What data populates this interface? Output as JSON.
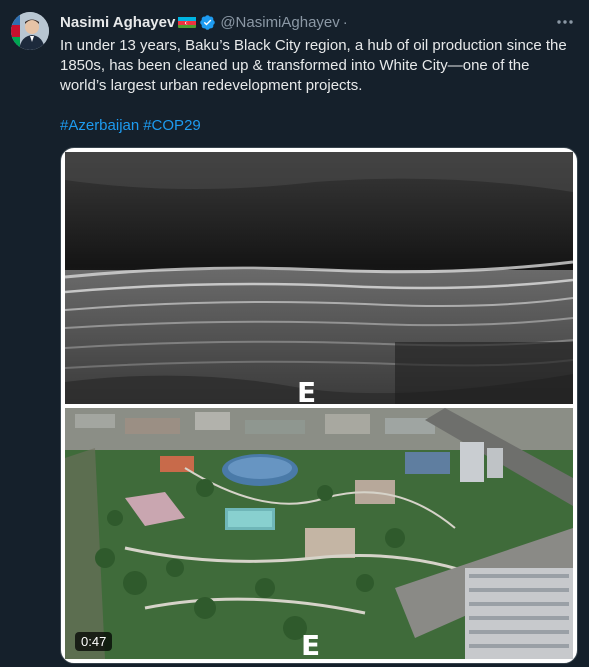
{
  "author": {
    "name": "Nasimi Aghayev",
    "handle": "@NasimiAghayev",
    "separator": "·"
  },
  "tweet": {
    "text": "In under 13 years, Baku’s Black City region, a hub of oil production since the 1850s, has been cleaned up & transformed into White City—one of the world’s largest urban redevelopment projects.",
    "hashtags": [
      "#Azerbaijan",
      "#COP29"
    ]
  },
  "media": {
    "duration": "0:47",
    "watermark": "Eko Etika"
  },
  "colors": {
    "background": "#15202b",
    "link": "#1d9bf0",
    "verified": "#1d9bf0",
    "text": "#e7e9ea",
    "muted": "#8b98a5"
  },
  "icons": {
    "verified": "verified-badge-icon",
    "more": "more-options-icon",
    "flag": "azerbaijan-flag-icon"
  }
}
